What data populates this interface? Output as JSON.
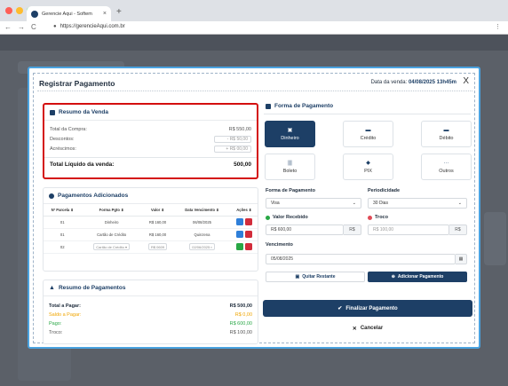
{
  "browser": {
    "tab_title": "Gerencie Aqui - Softem",
    "tab_close": "×",
    "new_tab": "+",
    "url_prefix": "https://",
    "url_host": "gerencieAqui.com.br",
    "back": "←",
    "forward": "→",
    "reload": "C",
    "menu": "⋮",
    "traffic_colors": [
      "#ff5f57",
      "#febc2e",
      "#28c840"
    ]
  },
  "modal": {
    "title": "Registrar Pagamento",
    "date_label": "Data da venda:",
    "date_value": "04/08/2025 13h45m",
    "close": "X"
  },
  "resumo": {
    "header": "Resumo da Venda",
    "total_compra_label": "Total da Compra:",
    "total_compra_value": "R$ 550,00",
    "descontos_label": "Descontos:",
    "descontos_value": "- R$ 50,00",
    "acrescimos_label": "Acréscimos:",
    "acrescimos_value": "+ R$ 00,00",
    "total_liquido_label": "Total Líquido da venda:",
    "total_liquido_value": "500,00"
  },
  "pagamentos": {
    "header": "Pagamentos Adicionados",
    "columns": [
      "Nº Parcela",
      "Forma Pgto",
      "Valor",
      "Data Vencimento",
      "Ações"
    ],
    "rows": [
      {
        "parcela": "01",
        "forma": "Dinheiro",
        "valor": "R$ 160,00",
        "data": "06/08/2025"
      },
      {
        "parcela": "01",
        "forma": "Cartão de Crédito",
        "valor": "R$ 160,00",
        "data": "Quinzena"
      },
      {
        "parcela": "02",
        "forma": "Cartão de Crédito",
        "valor": "R$ 0609",
        "data": "02/06/2025"
      }
    ]
  },
  "resumo_pag": {
    "header": "Resumo de Pagamentos",
    "total_pagar_label": "Total a Pagar:",
    "total_pagar_value": "R$ 500,00",
    "saldo_label": "Saldo a Pagar:",
    "saldo_value": "R$ 0,00",
    "pago_label": "Pago:",
    "pago_value": "R$ 600,00",
    "troco_label": "Troco:",
    "troco_value": "R$ 100,00",
    "saldo_color": "#f0a500",
    "pago_color": "#28a745"
  },
  "forma": {
    "header": "Forma de Pagamento",
    "methods": [
      {
        "label": "Dinheiro",
        "icon": "▣"
      },
      {
        "label": "Crédito",
        "icon": "▬"
      },
      {
        "label": "Débito",
        "icon": "▬"
      },
      {
        "label": "Boleto",
        "icon": "|||"
      },
      {
        "label": "PIX",
        "icon": "◆"
      },
      {
        "label": "Outros",
        "icon": "···"
      }
    ],
    "forma_label": "Forma de Pagamento",
    "forma_value": "Visa",
    "periodicidade_label": "Periodicidade",
    "periodicidade_value": "30 Dias",
    "valor_recebido_label": "Valor Recebido",
    "valor_recebido_value": "R$ 600,00",
    "currency": "R$",
    "troco_label": "Troco",
    "troco_value": "R$ 100,00",
    "vencimento_label": "Vencimento",
    "vencimento_value": "05/08/2025",
    "quitar_label": "Quitar Restante",
    "adicionar_label": "Adicionar Pagamento",
    "finalizar_label": "Finalizar Pagamento",
    "cancelar_label": "Cancelar"
  },
  "colors": {
    "brand": "#1d3f66",
    "highlight": "#d40f0f",
    "edit": "#2f7fd9",
    "delete": "#d22c3b",
    "confirm": "#28a745"
  }
}
